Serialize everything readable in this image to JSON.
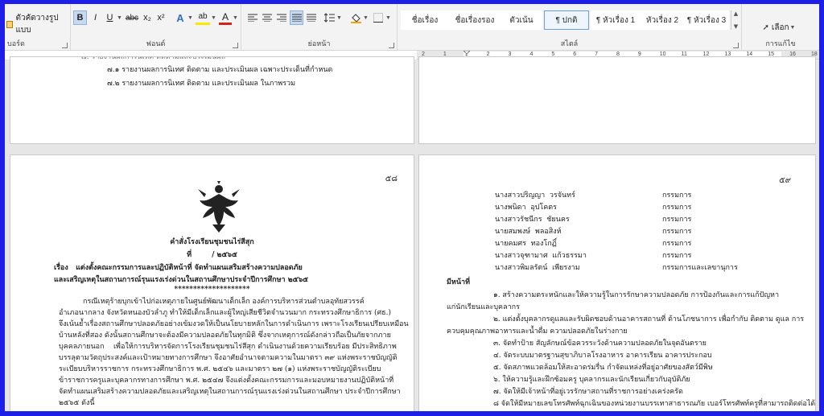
{
  "ribbon": {
    "clipboard": {
      "format_painter_label": "ตัวคัดวางรูปแบบ",
      "group_label": "บอร์ด"
    },
    "font": {
      "bold": "B",
      "italic": "I",
      "underline": "U",
      "strike": "abc",
      "subscript": "x₂",
      "superscript": "x²",
      "text_effects": "A",
      "highlight": "ab",
      "font_color": "A",
      "group_label": "ฟอนต์"
    },
    "paragraph": {
      "group_label": "ย่อหน้า"
    },
    "styles": {
      "items": [
        {
          "label": "ชื่อเรื่อง"
        },
        {
          "label": "ชื่อเรื่องรอง"
        },
        {
          "label": "ตัวเน้น"
        },
        {
          "label": "¶ ปกติ"
        },
        {
          "label": "¶ หัวเรื่อง 1"
        },
        {
          "label": "หัวเรื่อง 2"
        },
        {
          "label": "¶ หัวเรื่อง 3"
        }
      ],
      "group_label": "สไตล์"
    },
    "editing": {
      "select_label": "เลือก",
      "group_label": "การแก้ไข"
    }
  },
  "ruler": {
    "ticks": [
      "2",
      "1",
      "1",
      "2",
      "3",
      "4",
      "5",
      "6",
      "7",
      "8",
      "9",
      "10",
      "11",
      "12",
      "13",
      "14",
      "15",
      "16",
      "18"
    ]
  },
  "page_a": {
    "lines": [
      "๗.๑ รายงานผลการนิเทศ ติดตาม และประเมินผล เฉพาะประเด็นที่กำหนด",
      "๗.๒ รายงานผลการนิเทศ ติดตาม และประเมินผล ในภาพรวม"
    ]
  },
  "page_c": {
    "page_number": "๕๘",
    "title": "คำสั่งโรงเรียนชุมชนไร่สีสุก",
    "order_no": "ที่        / ๒๕๖๕",
    "subject_1": "เรื่อง   แต่งตั้งคณะกรรมการและปฏิบัติหน้าที่ จัดทำแผนเสริมสร้างความปลอดภัย",
    "subject_2": "และเสริญเหตุในสถานการณ์รุนแรงเร่งด่วนในสถานศึกษาประจำปีการศึกษา ๒๕๖๕",
    "stars": "********************",
    "body": [
      "กรณีเหตุร้ายบุกเข้าไปก่อเหตุภายในศูนย์พัฒนาเด็กเล็ก องค์การบริหารส่วนตำบลอุทัยสวรรค์",
      "อำเภอนากลาง จังหวัดหนองบัวลำภู ทำให้มีเด็กเล็กและผู้ใหญ่เสียชีวิตจำนวนมาก กระทรวงศึกษาธิการ (ศธ.)",
      "จึงเน้นย้ำเรื่องสถานศึกษาปลอดภัยอย่างเข้มงวดให้เป็นนโยบายหลักในการดำเนินการ เพราะโรงเรียนเปรียบเหมือน",
      "บ้านหลังที่สอง ดังนั้นสถานศึกษาจะต้องมีความปลอดภัยในทุกมิติ ซึ่งจากเหตุการณ์ดังกล่าวถือเป็นภัยจากภาย",
      "บุคคลภายนอก    เพื่อให้การบริหารจัดการโรงเรียนชุมชนไร่สีสุก ดำเนินงานด้วยความเรียบร้อย มีประสิทธิภาพ",
      "บรรลุตามวัตถุประสงค์และเป้าหมายทางการศึกษา จึงอาศัยอำนาจตามความในมาตรา ๓๙ แห่งพระราชบัญญัติ",
      "ระเบียบบริหารราชการ กระทรวงศึกษาธิการ พ.ศ. ๒๕๔๖ และมาตรา ๒๗ (๑) แห่งพระราชบัญญัติระเบียบ",
      "ข้าราชการครูและบุคลากรทางการศึกษา พ.ศ. ๒๕๔๗ จึงแต่งตั้งคณะกรรมการและมอบหมายงานปฏิบัติหน้าที่",
      "จัดทำแผนเสริมสร้างความปลอดภัยและเสริญเหตุในสถานการณ์รุนแรงเร่งด่วนในสถานศึกษา ประจำปีการศึกษา",
      "๒๕๖๕ ดังนี้"
    ]
  },
  "page_d": {
    "page_number": "๕๙",
    "members": [
      {
        "name": "นางสาวปริญญา  วรจันทร์",
        "role": "กรรมการ"
      },
      {
        "name": "นางพนิดา  อุปโคตร",
        "role": "กรรมการ"
      },
      {
        "name": "นางสาวรัชนีกร  ชัยนคร",
        "role": "กรรมการ"
      },
      {
        "name": "นายสมพงษ์  พลอสิงห์",
        "role": "กรรมการ"
      },
      {
        "name": "นายคมศร  ทองโกฏิ์",
        "role": "กรรมการ"
      },
      {
        "name": "นางสาวจุฑามาศ  แก้วธรรมา",
        "role": "กรรมการ"
      },
      {
        "name": "นางสาวพิมลรัตน์  เพียรงาม",
        "role": "กรรมการและเลขานุการ"
      }
    ],
    "duty_heading": "มีหน้าที่",
    "duties": [
      "๑. สร้างความตระหนักและให้ความรู้ในการรักษาความปลอดภัย การป้องกันและการแก้ปัญหา",
      "แก่นักเรียนและบุคลากร",
      "๒. แต่งตั้งบุคลากรดูแลและรับผิดชอบด้านอาคารสถานที่ ด้านโภชนาการ เพื่อกำกับ ติดตาม ดูแล การ",
      "ควบคุมคุณภาพอาหารและน้ำดื่ม ความปลอดภัยในร่างกาย",
      "๓. จัดทำป้าย สัญลักษณ์ข้อควรระวังด้านความปลอดภัยในจุดอันตราย",
      "๔. จัดระบบมาตรฐานสุขาภิบาลโรงอาหาร อาคารเรียน อาคารประกอบ",
      "๕. จัดสภาพแวดล้อมให้สะอาดร่มรื่น กำจัดแหล่งที่อยู่อาศัยของสัตว์มีพิษ",
      "๖. ให้ความรู้และฝึกซ้อมครู บุคลากรและนักเรียนเกี่ยวกับอุบัติภัย",
      "๗. จัดให้มีเจ้าหน้าที่อยู่เวรรักษาสถานที่ราชการอย่างเคร่งครัด",
      "๘ จัดให้มีหมายเลขโทรศัพท์ฉุกเฉินของหน่วยงานบรรเทาสาธารณภัย เบอร์โทรศัพท์ครูที่สามารถติดต่อได้"
    ]
  }
}
